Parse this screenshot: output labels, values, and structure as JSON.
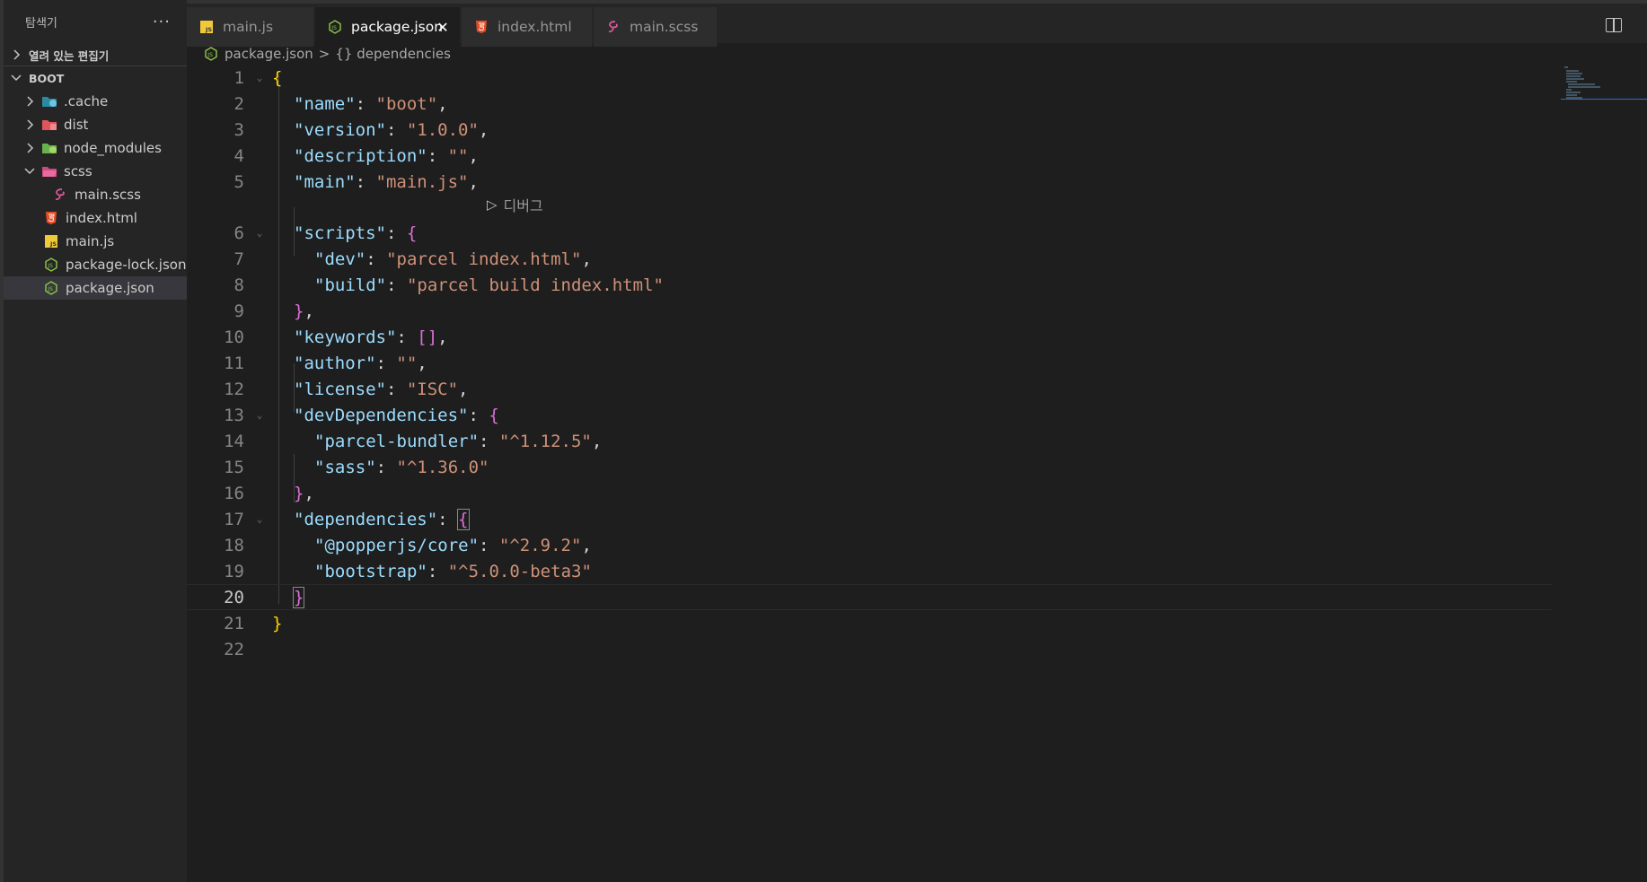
{
  "sidebar": {
    "title": "탐색기",
    "more": "···",
    "open_editors": "열려 있는 편집기",
    "project": "BOOT",
    "items": [
      {
        "label": ".cache",
        "icon": "folder-cache-icon",
        "expanded": false,
        "depth": 1
      },
      {
        "label": "dist",
        "icon": "folder-dist-icon",
        "expanded": false,
        "depth": 1
      },
      {
        "label": "node_modules",
        "icon": "folder-node-icon",
        "expanded": false,
        "depth": 1
      },
      {
        "label": "scss",
        "icon": "folder-sass-icon",
        "expanded": true,
        "depth": 1
      },
      {
        "label": "main.scss",
        "icon": "sass-file-icon",
        "depth": 2
      },
      {
        "label": "index.html",
        "icon": "html-file-icon",
        "depth": 1
      },
      {
        "label": "main.js",
        "icon": "js-file-icon",
        "depth": 1
      },
      {
        "label": "package-lock.json",
        "icon": "node-file-icon",
        "depth": 1
      },
      {
        "label": "package.json",
        "icon": "node-file-icon",
        "depth": 1,
        "selected": true
      }
    ]
  },
  "tabs": [
    {
      "label": "main.js",
      "icon": "js-file-icon"
    },
    {
      "label": "package.json",
      "icon": "node-file-icon",
      "active": true,
      "close": "✕"
    },
    {
      "label": "index.html",
      "icon": "html-file-icon"
    },
    {
      "label": "main.scss",
      "icon": "sass-file-icon"
    }
  ],
  "breadcrumb": {
    "file": "package.json",
    "sep": ">",
    "symbol": "{} dependencies"
  },
  "editor": {
    "codelens": "디버그",
    "current_line": 20,
    "line_numbers": [
      "1",
      "2",
      "3",
      "4",
      "5",
      "6",
      "7",
      "8",
      "9",
      "10",
      "11",
      "12",
      "13",
      "14",
      "15",
      "16",
      "17",
      "18",
      "19",
      "20",
      "21",
      "22"
    ]
  },
  "colors": {
    "key": "#9cdcfe",
    "string": "#ce9178",
    "bracket_level1": "#ffd700",
    "bracket_level2": "#da70d6",
    "bracket_level3": "#179fff"
  }
}
